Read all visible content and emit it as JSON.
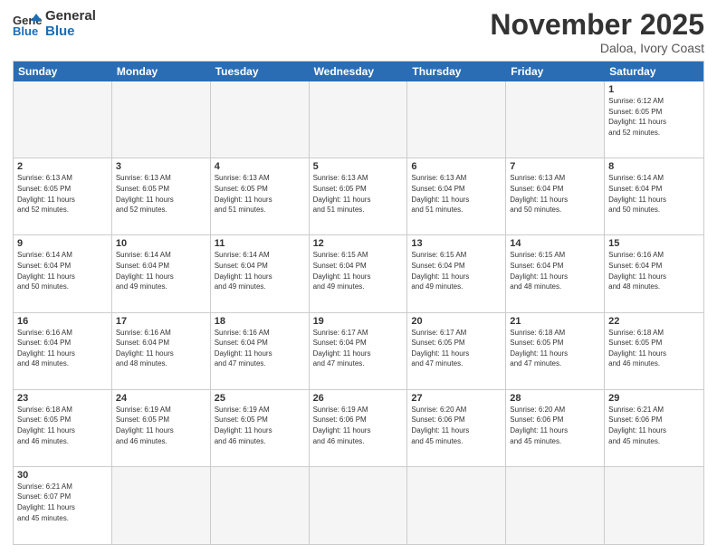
{
  "header": {
    "logo_general": "General",
    "logo_blue": "Blue",
    "month_title": "November 2025",
    "location": "Daloa, Ivory Coast"
  },
  "days_of_week": [
    "Sunday",
    "Monday",
    "Tuesday",
    "Wednesday",
    "Thursday",
    "Friday",
    "Saturday"
  ],
  "weeks": [
    [
      {
        "day": "",
        "info": ""
      },
      {
        "day": "",
        "info": ""
      },
      {
        "day": "",
        "info": ""
      },
      {
        "day": "",
        "info": ""
      },
      {
        "day": "",
        "info": ""
      },
      {
        "day": "",
        "info": ""
      },
      {
        "day": "1",
        "info": "Sunrise: 6:12 AM\nSunset: 6:05 PM\nDaylight: 11 hours\nand 52 minutes."
      }
    ],
    [
      {
        "day": "2",
        "info": "Sunrise: 6:13 AM\nSunset: 6:05 PM\nDaylight: 11 hours\nand 52 minutes."
      },
      {
        "day": "3",
        "info": "Sunrise: 6:13 AM\nSunset: 6:05 PM\nDaylight: 11 hours\nand 52 minutes."
      },
      {
        "day": "4",
        "info": "Sunrise: 6:13 AM\nSunset: 6:05 PM\nDaylight: 11 hours\nand 51 minutes."
      },
      {
        "day": "5",
        "info": "Sunrise: 6:13 AM\nSunset: 6:05 PM\nDaylight: 11 hours\nand 51 minutes."
      },
      {
        "day": "6",
        "info": "Sunrise: 6:13 AM\nSunset: 6:04 PM\nDaylight: 11 hours\nand 51 minutes."
      },
      {
        "day": "7",
        "info": "Sunrise: 6:13 AM\nSunset: 6:04 PM\nDaylight: 11 hours\nand 50 minutes."
      },
      {
        "day": "8",
        "info": "Sunrise: 6:14 AM\nSunset: 6:04 PM\nDaylight: 11 hours\nand 50 minutes."
      }
    ],
    [
      {
        "day": "9",
        "info": "Sunrise: 6:14 AM\nSunset: 6:04 PM\nDaylight: 11 hours\nand 50 minutes."
      },
      {
        "day": "10",
        "info": "Sunrise: 6:14 AM\nSunset: 6:04 PM\nDaylight: 11 hours\nand 49 minutes."
      },
      {
        "day": "11",
        "info": "Sunrise: 6:14 AM\nSunset: 6:04 PM\nDaylight: 11 hours\nand 49 minutes."
      },
      {
        "day": "12",
        "info": "Sunrise: 6:15 AM\nSunset: 6:04 PM\nDaylight: 11 hours\nand 49 minutes."
      },
      {
        "day": "13",
        "info": "Sunrise: 6:15 AM\nSunset: 6:04 PM\nDaylight: 11 hours\nand 49 minutes."
      },
      {
        "day": "14",
        "info": "Sunrise: 6:15 AM\nSunset: 6:04 PM\nDaylight: 11 hours\nand 48 minutes."
      },
      {
        "day": "15",
        "info": "Sunrise: 6:16 AM\nSunset: 6:04 PM\nDaylight: 11 hours\nand 48 minutes."
      }
    ],
    [
      {
        "day": "16",
        "info": "Sunrise: 6:16 AM\nSunset: 6:04 PM\nDaylight: 11 hours\nand 48 minutes."
      },
      {
        "day": "17",
        "info": "Sunrise: 6:16 AM\nSunset: 6:04 PM\nDaylight: 11 hours\nand 48 minutes."
      },
      {
        "day": "18",
        "info": "Sunrise: 6:16 AM\nSunset: 6:04 PM\nDaylight: 11 hours\nand 47 minutes."
      },
      {
        "day": "19",
        "info": "Sunrise: 6:17 AM\nSunset: 6:04 PM\nDaylight: 11 hours\nand 47 minutes."
      },
      {
        "day": "20",
        "info": "Sunrise: 6:17 AM\nSunset: 6:05 PM\nDaylight: 11 hours\nand 47 minutes."
      },
      {
        "day": "21",
        "info": "Sunrise: 6:18 AM\nSunset: 6:05 PM\nDaylight: 11 hours\nand 47 minutes."
      },
      {
        "day": "22",
        "info": "Sunrise: 6:18 AM\nSunset: 6:05 PM\nDaylight: 11 hours\nand 46 minutes."
      }
    ],
    [
      {
        "day": "23",
        "info": "Sunrise: 6:18 AM\nSunset: 6:05 PM\nDaylight: 11 hours\nand 46 minutes."
      },
      {
        "day": "24",
        "info": "Sunrise: 6:19 AM\nSunset: 6:05 PM\nDaylight: 11 hours\nand 46 minutes."
      },
      {
        "day": "25",
        "info": "Sunrise: 6:19 AM\nSunset: 6:05 PM\nDaylight: 11 hours\nand 46 minutes."
      },
      {
        "day": "26",
        "info": "Sunrise: 6:19 AM\nSunset: 6:06 PM\nDaylight: 11 hours\nand 46 minutes."
      },
      {
        "day": "27",
        "info": "Sunrise: 6:20 AM\nSunset: 6:06 PM\nDaylight: 11 hours\nand 45 minutes."
      },
      {
        "day": "28",
        "info": "Sunrise: 6:20 AM\nSunset: 6:06 PM\nDaylight: 11 hours\nand 45 minutes."
      },
      {
        "day": "29",
        "info": "Sunrise: 6:21 AM\nSunset: 6:06 PM\nDaylight: 11 hours\nand 45 minutes."
      }
    ],
    [
      {
        "day": "30",
        "info": "Sunrise: 6:21 AM\nSunset: 6:07 PM\nDaylight: 11 hours\nand 45 minutes."
      },
      {
        "day": "",
        "info": ""
      },
      {
        "day": "",
        "info": ""
      },
      {
        "day": "",
        "info": ""
      },
      {
        "day": "",
        "info": ""
      },
      {
        "day": "",
        "info": ""
      },
      {
        "day": "",
        "info": ""
      }
    ]
  ]
}
